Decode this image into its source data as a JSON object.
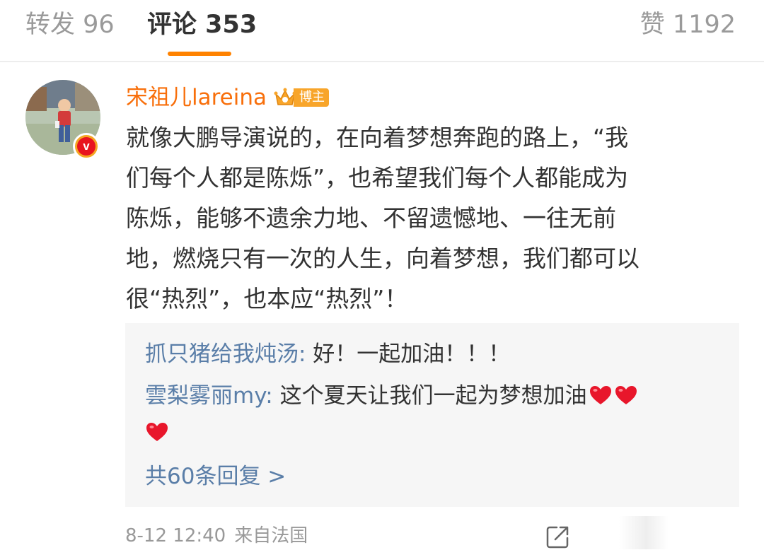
{
  "tabs": {
    "repost": "转发 96",
    "comment": "评论 353",
    "like": "赞 1192"
  },
  "colors": {
    "accent": "#ff8200",
    "username": "#f86f0b",
    "link": "#5a7ea8",
    "text": "#333333",
    "muted": "#999999"
  },
  "comment": {
    "username": "宋祖儿lareina",
    "badge_label": "博主",
    "verify_label": "v",
    "icons": [
      "crown-icon",
      "verified-badge-icon"
    ],
    "text_lines": [
      "就像大鹏导演说的，在向着梦想奔跑的路上，“我",
      "们每个人都是陈烁”，也希望我们每个人都能成为",
      "陈烁，能够不遗余力地、不留遗憾地、一往无前",
      "地，燃烧只有一次的人生，向着梦想，我们都可以",
      "很“热烈”，也本应“热烈”！"
    ],
    "time": "8-12 12:40",
    "source": "来自法国"
  },
  "replies": {
    "items": [
      {
        "author": "抓只猪给我炖汤:",
        "text": " 好！一起加油！！！"
      },
      {
        "author": "雲梨雾丽my:",
        "text": " 这个夏天让我们一起为梦想加油"
      }
    ],
    "more_label": "共60条回复 >"
  }
}
